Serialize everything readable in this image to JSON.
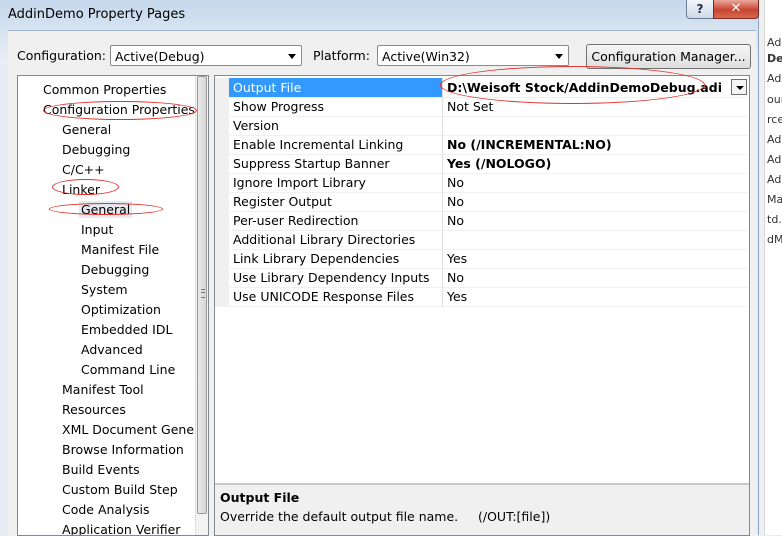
{
  "window": {
    "title": "AddinDemo Property Pages",
    "help_label": "?",
    "close_label": "✕"
  },
  "toolbar": {
    "configuration_label": "Configuration:",
    "configuration_value": "Active(Debug)",
    "platform_label": "Platform:",
    "platform_value": "Active(Win32)",
    "config_manager_label": "Configuration Manager..."
  },
  "tree": {
    "items": [
      "Common Properties",
      "Configuration Properties",
      "General",
      "Debugging",
      "C/C++",
      "Linker",
      "General",
      "Input",
      "Manifest File",
      "Debugging",
      "System",
      "Optimization",
      "Embedded IDL",
      "Advanced",
      "Command Line",
      "Manifest Tool",
      "Resources",
      "XML Document Gene",
      "Browse Information",
      "Build Events",
      "Custom Build Step",
      "Code Analysis",
      "Application Verifier"
    ],
    "selected": "General"
  },
  "grid": {
    "rows": [
      {
        "name": "Output File",
        "value": "D:\\Weisoft Stock/AddinDemoDebug.adi"
      },
      {
        "name": "Show Progress",
        "value": "Not Set"
      },
      {
        "name": "Version",
        "value": ""
      },
      {
        "name": "Enable Incremental Linking",
        "value": "No (/INCREMENTAL:NO)"
      },
      {
        "name": "Suppress Startup Banner",
        "value": "Yes (/NOLOGO)"
      },
      {
        "name": "Ignore Import Library",
        "value": "No"
      },
      {
        "name": "Register Output",
        "value": "No"
      },
      {
        "name": "Per-user Redirection",
        "value": "No"
      },
      {
        "name": "Additional Library Directories",
        "value": ""
      },
      {
        "name": "Link Library Dependencies",
        "value": "Yes"
      },
      {
        "name": "Use Library Dependency Inputs",
        "value": "No"
      },
      {
        "name": "Use UNICODE Response Files",
        "value": "Yes"
      }
    ]
  },
  "description": {
    "title": "Output File",
    "text": "Override the default output file name.     (/OUT:[file])"
  },
  "background_window_fragments": [
    "Add",
    "Der",
    "Add",
    "our",
    "rce",
    "Add",
    "Add",
    "Add",
    "Ma",
    "td.",
    "dM"
  ]
}
